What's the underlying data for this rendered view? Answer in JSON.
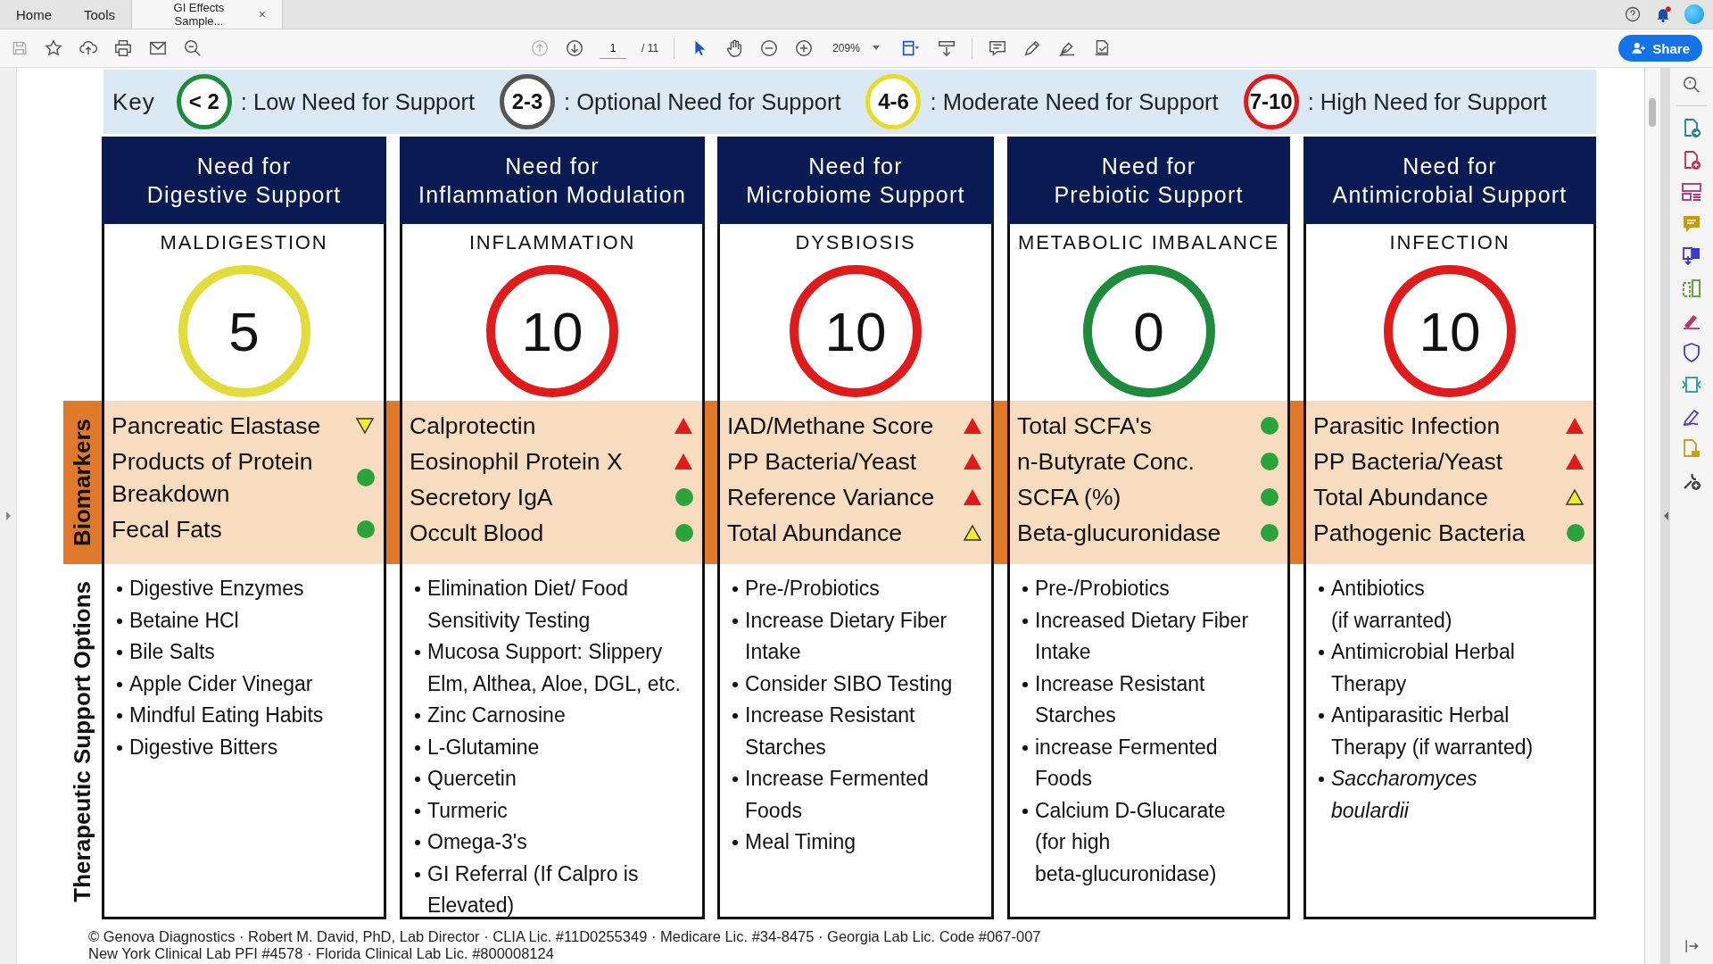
{
  "tabs": [
    {
      "label": "Home",
      "selected": false
    },
    {
      "label": "Tools",
      "selected": false
    },
    {
      "label": "GI Effects Sample...",
      "selected": true,
      "close": "×"
    }
  ],
  "toolbar": {
    "page": "1",
    "page_count": "/ 11",
    "zoom": "209%",
    "share": "Share"
  },
  "key": {
    "label": "Key",
    "items": [
      {
        "badge": "< 2",
        "color": "#1e8a3c",
        "text": ": Low Need for Support"
      },
      {
        "badge": "2-3",
        "color": "#555555",
        "text": ": Optional Need for Support"
      },
      {
        "badge": "4-6",
        "color": "#e8dc2a",
        "text": ": Moderate Need for Support"
      },
      {
        "badge": "7-10",
        "color": "#e01b1b",
        "text": ": High Need for Support"
      }
    ]
  },
  "row_labels": {
    "biomarkers": "Biomarkers",
    "therapy": "Therapeutic Support Options"
  },
  "columns": [
    {
      "header": "Need for\nDigestive Support",
      "title": "MALDIGESTION",
      "score": "5",
      "color": "#e2dc3a",
      "biomarkers": [
        {
          "name": "Pancreatic Elastase",
          "kind": "low"
        },
        {
          "name": "Products of Protein Breakdown",
          "kind": "normal"
        },
        {
          "name": "Fecal Fats",
          "kind": "normal"
        }
      ],
      "therapy": [
        {
          "text": "Digestive Enzymes"
        },
        {
          "text": "Betaine HCl"
        },
        {
          "text": "Bile Salts"
        },
        {
          "text": "Apple Cider Vinegar"
        },
        {
          "text": "Mindful Eating Habits"
        },
        {
          "text": "Digestive Bitters"
        }
      ]
    },
    {
      "header": "Need for\nInflammation Modulation",
      "title": "INFLAMMATION",
      "score": "10",
      "color": "#e01b1b",
      "biomarkers": [
        {
          "name": "Calprotectin",
          "kind": "high"
        },
        {
          "name": "Eosinophil Protein X",
          "kind": "high"
        },
        {
          "name": "Secretory IgA",
          "kind": "normal"
        },
        {
          "name": "Occult Blood",
          "kind": "normal"
        }
      ],
      "therapy": [
        {
          "text": "Elimination Diet/ Food Sensitivity Testing"
        },
        {
          "text": "Mucosa Support: Slippery Elm, Althea, Aloe, DGL, etc."
        },
        {
          "text": "Zinc Carnosine"
        },
        {
          "text": "L-Glutamine"
        },
        {
          "text": "Quercetin"
        },
        {
          "text": "Turmeric"
        },
        {
          "text": "Omega-3's"
        },
        {
          "text": "GI Referral (If Calpro is Elevated)"
        }
      ]
    },
    {
      "header": "Need for\nMicrobiome Support",
      "title": "DYSBIOSIS",
      "score": "10",
      "color": "#e01b1b",
      "biomarkers": [
        {
          "name": "IAD/Methane Score",
          "kind": "high"
        },
        {
          "name": "PP Bacteria/Yeast",
          "kind": "high"
        },
        {
          "name": "Reference Variance",
          "kind": "high"
        },
        {
          "name": "Total Abundance",
          "kind": "borderline"
        }
      ],
      "therapy": [
        {
          "text": "Pre-/Probiotics"
        },
        {
          "text": "Increase Dietary Fiber Intake"
        },
        {
          "text": "Consider SIBO Testing"
        },
        {
          "text": "Increase Resistant Starches"
        },
        {
          "text": "Increase Fermented Foods"
        },
        {
          "text": "Meal Timing"
        }
      ]
    },
    {
      "header": "Need for\nPrebiotic Support",
      "title": "METABOLIC IMBALANCE",
      "score": "0",
      "color": "#1e8a3c",
      "biomarkers": [
        {
          "name": "Total SCFA's",
          "kind": "normal"
        },
        {
          "name": "n-Butyrate Conc.",
          "kind": "normal"
        },
        {
          "name": "SCFA (%)",
          "kind": "normal"
        },
        {
          "name": "Beta-glucuronidase",
          "kind": "normal"
        }
      ],
      "therapy": [
        {
          "text": "Pre-/Probiotics"
        },
        {
          "text": "Increased Dietary Fiber Intake"
        },
        {
          "text": "Increase Resistant Starches"
        },
        {
          "text": "increase Fermented Foods"
        },
        {
          "text": "Calcium D-Glucarate\n(for high\nbeta-glucuronidase)"
        }
      ]
    },
    {
      "header": "Need for\nAntimicrobial Support",
      "title": "INFECTION",
      "score": "10",
      "color": "#e01b1b",
      "biomarkers": [
        {
          "name": "Parasitic Infection",
          "kind": "high"
        },
        {
          "name": "PP Bacteria/Yeast",
          "kind": "high"
        },
        {
          "name": "Total Abundance",
          "kind": "borderline"
        },
        {
          "name": "Pathogenic Bacteria",
          "kind": "normal"
        }
      ],
      "therapy": [
        {
          "text": "Antibiotics\n(if warranted)"
        },
        {
          "text": "Antimicrobial Herbal Therapy"
        },
        {
          "text": "Antiparasitic Herbal Therapy (if warranted)"
        },
        {
          "text": "Saccharomyces\nboulardii",
          "italic": true
        }
      ]
    }
  ],
  "footer": [
    "© Genova Diagnostics · Robert M. David, PhD, Lab Director · CLIA Lic. #11D0255349 · Medicare Lic. #34-8475 · Georgia Lab Lic. Code #067-007",
    "New York Clinical Lab PFI #4578 · Florida Clinical Lab Lic. #800008124"
  ]
}
